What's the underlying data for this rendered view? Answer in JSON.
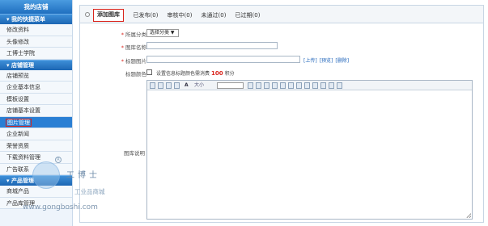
{
  "sidebar": {
    "title": "我的店铺",
    "quick_section": "▾ 我的快捷菜单",
    "quick_items": [
      "修改资料",
      "头像修改",
      "工博士学院"
    ],
    "shop_section": "▾ 店铺管理",
    "shop_items": [
      "店铺预览",
      "企业基本信息",
      "模板设置",
      "店铺基本设置",
      "图片管理",
      "企业新闻",
      "荣誉资质",
      "下载资料管理",
      "广告联系"
    ],
    "active_item": "图片管理",
    "product_section": "▾ 产品管理",
    "product_items": [
      "商城产品",
      "产品库管理"
    ]
  },
  "tabs": [
    "添加图库",
    "已发布(0)",
    "审核中(0)",
    "未通过(0)",
    "已过期(0)"
  ],
  "active_tab": "添加图库",
  "form": {
    "category_label": "所属分类",
    "category_value": "选择分类 ▼",
    "name_label": "图库名称",
    "image_label": "标题图片",
    "image_links": [
      "[上传]",
      "[预览]",
      "[删除]"
    ],
    "color_label": "标题颜色",
    "color_text_before": "设置信息标题颜色需消费",
    "color_points": "100",
    "color_text_after": "积分",
    "desc_label": "图库说明",
    "toolbar_font": "A",
    "toolbar_size": "大小"
  },
  "watermark": {
    "brand": "工博士",
    "subtitle": "工业品商城",
    "url": "www.gongboshi.com",
    "reg": "R"
  },
  "colors": {
    "accent": "#2a7fd4",
    "highlight": "#d9241c",
    "points": "#d9241c"
  }
}
